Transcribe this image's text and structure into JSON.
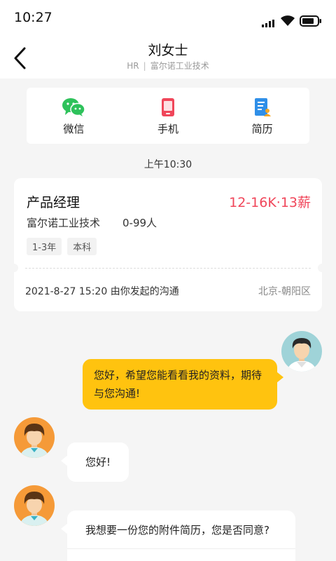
{
  "status_bar": {
    "time": "10:27",
    "icons": [
      "signal-icon",
      "wifi-icon",
      "battery-icon"
    ]
  },
  "header": {
    "title": "刘女士",
    "role": "HR",
    "separator": "|",
    "company": "富尔诺工业技术"
  },
  "quick_actions": [
    {
      "label": "微信",
      "icon": "wechat-icon"
    },
    {
      "label": "手机",
      "icon": "phone-icon"
    },
    {
      "label": "简历",
      "icon": "resume-icon"
    }
  ],
  "timestamp": "上午10:30",
  "job": {
    "title": "产品经理",
    "salary": "12-16K·13薪",
    "company": "富尔诺工业技术",
    "size": "0-99人",
    "tags": [
      "1-3年",
      "本科"
    ],
    "date_info": "2021-8-27  15:20 由你发起的沟通",
    "location": "北京-朝阳区"
  },
  "messages": [
    {
      "from": "me",
      "text_line1": "您好，希望您能看看我的资料，期待",
      "text_line2": "与您沟通!"
    },
    {
      "from": "hr",
      "text": "您好!"
    },
    {
      "from": "hr",
      "text": "我想要一份您的附件简历，您是否同意?"
    }
  ],
  "colors": {
    "accent": "#ffc30f",
    "salary": "#f0465a",
    "wechat": "#2ec25b",
    "phone": "#f0465a",
    "resume": "#2f8fe8"
  }
}
